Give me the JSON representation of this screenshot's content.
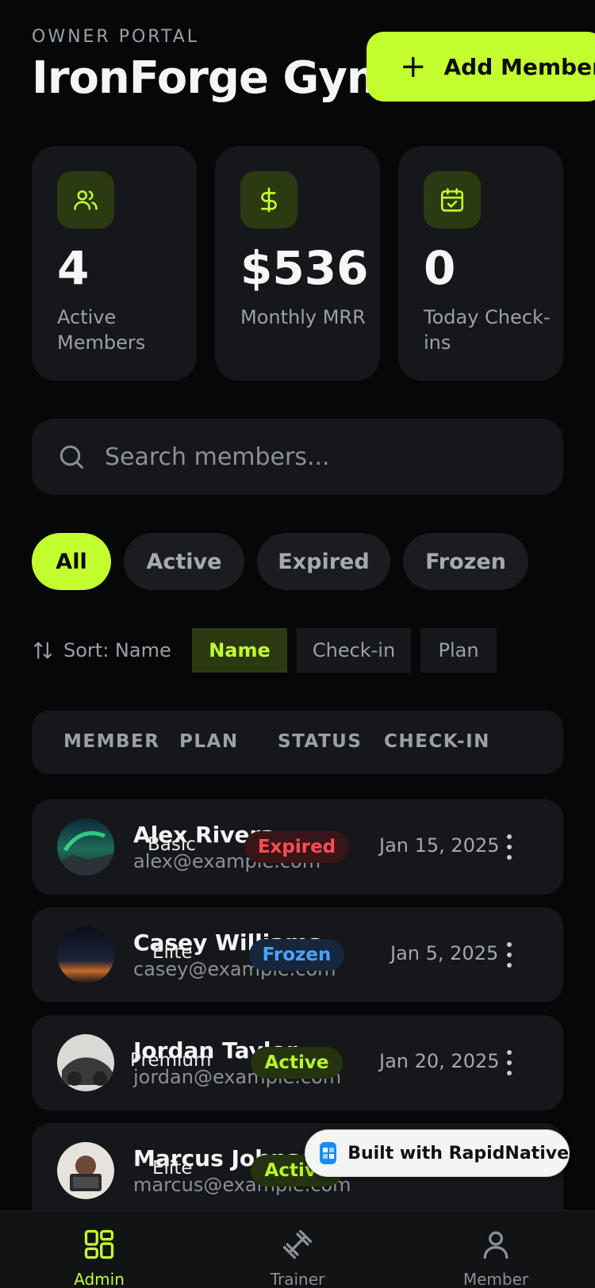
{
  "header": {
    "eyebrow": "OWNER PORTAL",
    "title": "IronForge Gym",
    "add_button": "Add Member"
  },
  "stats": [
    {
      "icon": "users-icon",
      "value": "4",
      "label": "Active Members"
    },
    {
      "icon": "dollar-icon",
      "value": "$536",
      "label": "Monthly MRR"
    },
    {
      "icon": "calendar-check-icon",
      "value": "0",
      "label": "Today Check-ins"
    }
  ],
  "search": {
    "placeholder": "Search members...",
    "value": ""
  },
  "filters": {
    "items": [
      "All",
      "Active",
      "Expired",
      "Frozen"
    ],
    "selected": "All"
  },
  "sort": {
    "label": "Sort: Name",
    "options": [
      "Name",
      "Check-in",
      "Plan"
    ],
    "selected": "Name"
  },
  "table": {
    "headers": [
      "MEMBER",
      "PLAN",
      "STATUS",
      "CHECK-IN"
    ],
    "rows": [
      {
        "name": "Alex Rivera",
        "email": "alex@example.com",
        "plan": "Basic",
        "status": "Expired",
        "checkin": "Jan 15, 2025"
      },
      {
        "name": "Casey Williams",
        "email": "casey@example.com",
        "plan": "Elite",
        "status": "Frozen",
        "checkin": "Jan 5, 2025"
      },
      {
        "name": "Jordan Taylor",
        "email": "jordan@example.com",
        "plan": "Premium",
        "status": "Active",
        "checkin": "Jan 20, 2025"
      },
      {
        "name": "Marcus Johnson",
        "email": "marcus@example.com",
        "plan": "Elite",
        "status": "Active",
        "checkin": ""
      }
    ]
  },
  "badge": {
    "text": "Built with RapidNative"
  },
  "tabbar": {
    "items": [
      "Admin",
      "Trainer",
      "Member"
    ],
    "selected": "Admin"
  },
  "colors": {
    "accent": "#c3ff2e",
    "background": "#060708",
    "card": "#15171a",
    "expired": "#ff4d55",
    "frozen": "#4ba3ff",
    "active": "#b8f52a"
  }
}
